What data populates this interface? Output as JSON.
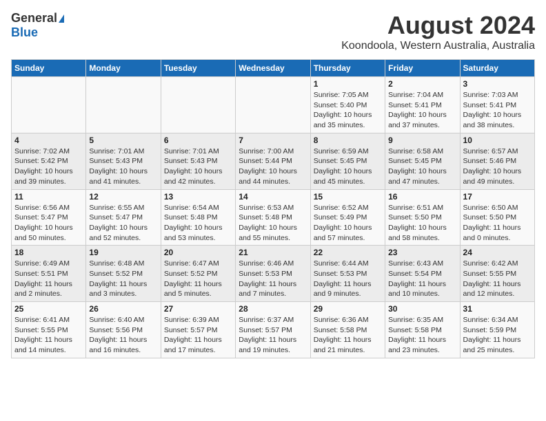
{
  "logo": {
    "general": "General",
    "blue": "Blue"
  },
  "title": "August 2024",
  "subtitle": "Koondoola, Western Australia, Australia",
  "days_of_week": [
    "Sunday",
    "Monday",
    "Tuesday",
    "Wednesday",
    "Thursday",
    "Friday",
    "Saturday"
  ],
  "weeks": [
    [
      {
        "day": "",
        "sunrise": "",
        "sunset": "",
        "daylight": ""
      },
      {
        "day": "",
        "sunrise": "",
        "sunset": "",
        "daylight": ""
      },
      {
        "day": "",
        "sunrise": "",
        "sunset": "",
        "daylight": ""
      },
      {
        "day": "",
        "sunrise": "",
        "sunset": "",
        "daylight": ""
      },
      {
        "day": "1",
        "sunrise": "7:05 AM",
        "sunset": "5:40 PM",
        "daylight": "10 hours and 35 minutes."
      },
      {
        "day": "2",
        "sunrise": "7:04 AM",
        "sunset": "5:41 PM",
        "daylight": "10 hours and 37 minutes."
      },
      {
        "day": "3",
        "sunrise": "7:03 AM",
        "sunset": "5:41 PM",
        "daylight": "10 hours and 38 minutes."
      }
    ],
    [
      {
        "day": "4",
        "sunrise": "7:02 AM",
        "sunset": "5:42 PM",
        "daylight": "10 hours and 39 minutes."
      },
      {
        "day": "5",
        "sunrise": "7:01 AM",
        "sunset": "5:43 PM",
        "daylight": "10 hours and 41 minutes."
      },
      {
        "day": "6",
        "sunrise": "7:01 AM",
        "sunset": "5:43 PM",
        "daylight": "10 hours and 42 minutes."
      },
      {
        "day": "7",
        "sunrise": "7:00 AM",
        "sunset": "5:44 PM",
        "daylight": "10 hours and 44 minutes."
      },
      {
        "day": "8",
        "sunrise": "6:59 AM",
        "sunset": "5:45 PM",
        "daylight": "10 hours and 45 minutes."
      },
      {
        "day": "9",
        "sunrise": "6:58 AM",
        "sunset": "5:45 PM",
        "daylight": "10 hours and 47 minutes."
      },
      {
        "day": "10",
        "sunrise": "6:57 AM",
        "sunset": "5:46 PM",
        "daylight": "10 hours and 49 minutes."
      }
    ],
    [
      {
        "day": "11",
        "sunrise": "6:56 AM",
        "sunset": "5:47 PM",
        "daylight": "10 hours and 50 minutes."
      },
      {
        "day": "12",
        "sunrise": "6:55 AM",
        "sunset": "5:47 PM",
        "daylight": "10 hours and 52 minutes."
      },
      {
        "day": "13",
        "sunrise": "6:54 AM",
        "sunset": "5:48 PM",
        "daylight": "10 hours and 53 minutes."
      },
      {
        "day": "14",
        "sunrise": "6:53 AM",
        "sunset": "5:48 PM",
        "daylight": "10 hours and 55 minutes."
      },
      {
        "day": "15",
        "sunrise": "6:52 AM",
        "sunset": "5:49 PM",
        "daylight": "10 hours and 57 minutes."
      },
      {
        "day": "16",
        "sunrise": "6:51 AM",
        "sunset": "5:50 PM",
        "daylight": "10 hours and 58 minutes."
      },
      {
        "day": "17",
        "sunrise": "6:50 AM",
        "sunset": "5:50 PM",
        "daylight": "11 hours and 0 minutes."
      }
    ],
    [
      {
        "day": "18",
        "sunrise": "6:49 AM",
        "sunset": "5:51 PM",
        "daylight": "11 hours and 2 minutes."
      },
      {
        "day": "19",
        "sunrise": "6:48 AM",
        "sunset": "5:52 PM",
        "daylight": "11 hours and 3 minutes."
      },
      {
        "day": "20",
        "sunrise": "6:47 AM",
        "sunset": "5:52 PM",
        "daylight": "11 hours and 5 minutes."
      },
      {
        "day": "21",
        "sunrise": "6:46 AM",
        "sunset": "5:53 PM",
        "daylight": "11 hours and 7 minutes."
      },
      {
        "day": "22",
        "sunrise": "6:44 AM",
        "sunset": "5:53 PM",
        "daylight": "11 hours and 9 minutes."
      },
      {
        "day": "23",
        "sunrise": "6:43 AM",
        "sunset": "5:54 PM",
        "daylight": "11 hours and 10 minutes."
      },
      {
        "day": "24",
        "sunrise": "6:42 AM",
        "sunset": "5:55 PM",
        "daylight": "11 hours and 12 minutes."
      }
    ],
    [
      {
        "day": "25",
        "sunrise": "6:41 AM",
        "sunset": "5:55 PM",
        "daylight": "11 hours and 14 minutes."
      },
      {
        "day": "26",
        "sunrise": "6:40 AM",
        "sunset": "5:56 PM",
        "daylight": "11 hours and 16 minutes."
      },
      {
        "day": "27",
        "sunrise": "6:39 AM",
        "sunset": "5:57 PM",
        "daylight": "11 hours and 17 minutes."
      },
      {
        "day": "28",
        "sunrise": "6:37 AM",
        "sunset": "5:57 PM",
        "daylight": "11 hours and 19 minutes."
      },
      {
        "day": "29",
        "sunrise": "6:36 AM",
        "sunset": "5:58 PM",
        "daylight": "11 hours and 21 minutes."
      },
      {
        "day": "30",
        "sunrise": "6:35 AM",
        "sunset": "5:58 PM",
        "daylight": "11 hours and 23 minutes."
      },
      {
        "day": "31",
        "sunrise": "6:34 AM",
        "sunset": "5:59 PM",
        "daylight": "11 hours and 25 minutes."
      }
    ]
  ]
}
